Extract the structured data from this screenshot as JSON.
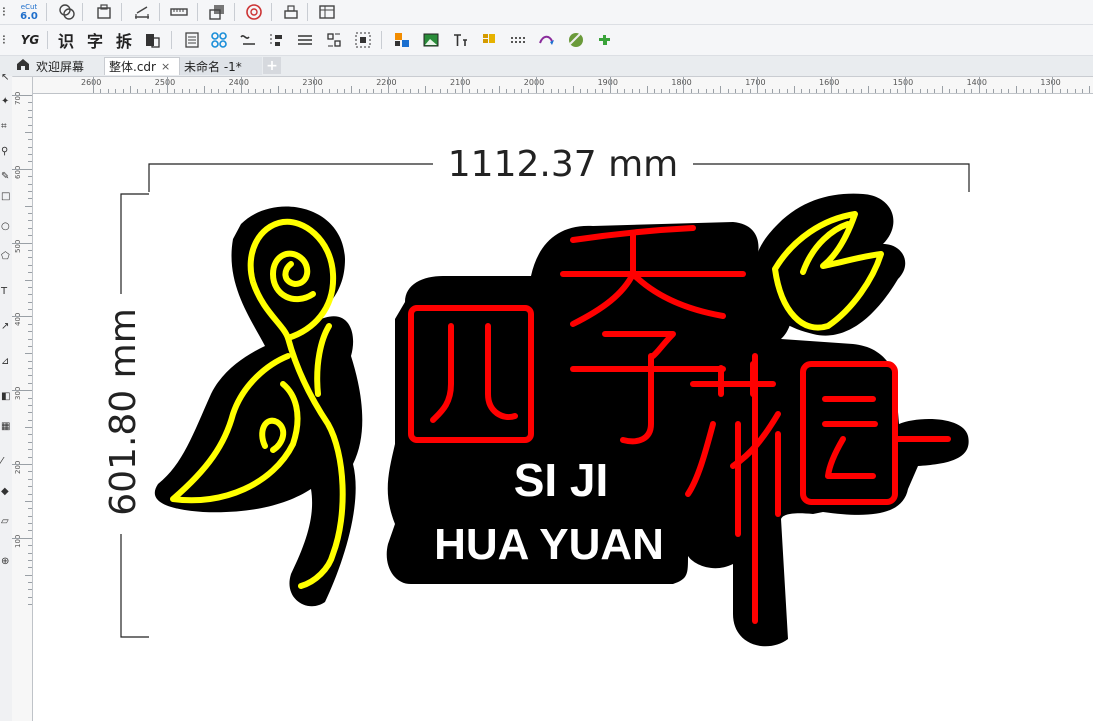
{
  "toolbar_top": {
    "ecut_logo_top": "eCut",
    "ecut_logo_version": "6.0"
  },
  "toolbar_second": {
    "yg_label": "YG",
    "recognize_label": "识",
    "text_label": "字",
    "split_label": "拆"
  },
  "tabs": [
    {
      "label": "欢迎屏幕",
      "close": ""
    },
    {
      "label": "整体.cdr",
      "close": "×"
    },
    {
      "label": "未命名 -1*",
      "close": ""
    }
  ],
  "ruler": {
    "horizontal": [
      "2600",
      "2500",
      "2400",
      "2300",
      "2200",
      "2100",
      "2000",
      "1900",
      "1800",
      "1700",
      "1600",
      "1500",
      "1400",
      "1300"
    ],
    "vertical": [
      "700",
      "600",
      "500",
      "400",
      "300",
      "200",
      "100"
    ]
  },
  "drawing": {
    "width_dimension": "1112.37 mm",
    "height_dimension": "601.80 mm",
    "sign_line1": "SI JI",
    "sign_line2": "HUA YUAN"
  },
  "colors": {
    "neon_red": "#ff0000",
    "neon_yellow": "#ffff00",
    "backing": "#000000",
    "text_white": "#ffffff"
  }
}
